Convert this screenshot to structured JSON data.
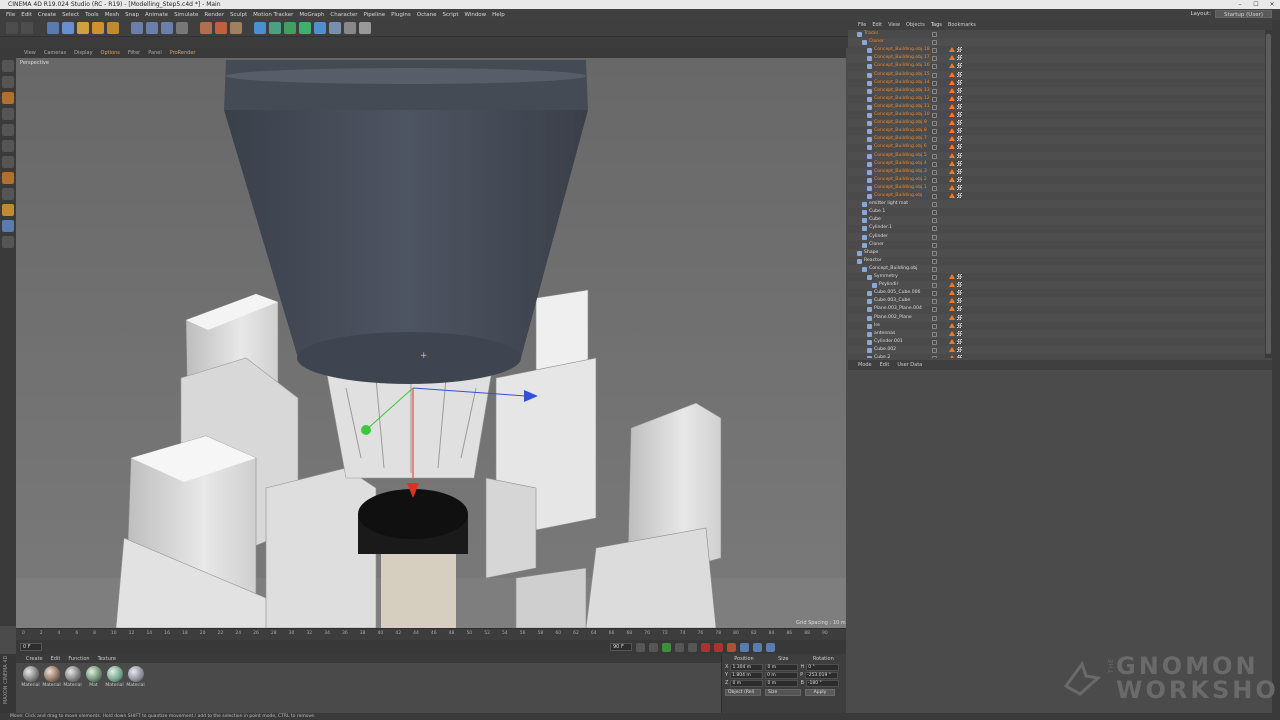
{
  "window": {
    "title": "CINEMA 4D R19.024 Studio (RC - R19) - [Modelling_Step5.c4d *] - Main",
    "controls": [
      "–",
      "☐",
      "✕"
    ]
  },
  "menubar": {
    "items": [
      "File",
      "Edit",
      "Create",
      "Select",
      "Tools",
      "Mesh",
      "Snap",
      "Animate",
      "Simulate",
      "Render",
      "Sculpt",
      "Motion Tracker",
      "MoGraph",
      "Character",
      "Pipeline",
      "Plugins",
      "Octane",
      "Script",
      "Window",
      "Help"
    ],
    "layout_label": "Layout:",
    "layout_value": "Startup (User)"
  },
  "viewport": {
    "menu": [
      "View",
      "Cameras",
      "Display",
      "Options",
      "Filter",
      "Panel",
      "ProRender"
    ],
    "active_menu": "Options",
    "label": "Perspective",
    "grid_spacing": "Grid Spacing : 10 m"
  },
  "timeline": {
    "ticks": [
      "0",
      "2",
      "4",
      "6",
      "8",
      "10",
      "12",
      "14",
      "16",
      "18",
      "20",
      "22",
      "24",
      "26",
      "28",
      "30",
      "32",
      "34",
      "36",
      "38",
      "40",
      "42",
      "44",
      "46",
      "48",
      "50",
      "52",
      "54",
      "56",
      "58",
      "60",
      "62",
      "64",
      "66",
      "68",
      "70",
      "72",
      "74",
      "76",
      "78",
      "80",
      "82",
      "84",
      "86",
      "88",
      "90"
    ],
    "end_label": "0 F",
    "current_frame": "0 F",
    "start_field": "0 F",
    "end_field": "90 F",
    "end_field2": "90 F"
  },
  "materials": {
    "menu": [
      "Create",
      "Edit",
      "Function",
      "Texture"
    ],
    "items": [
      "Material",
      "Material",
      "Material",
      "Mat",
      "Material",
      "Material"
    ]
  },
  "coordinates": {
    "headers": [
      "Position",
      "Size",
      "Rotation"
    ],
    "rows": [
      {
        "axis": "X",
        "pos": "1.304 m",
        "size": "0 m",
        "rot_axis": "H",
        "rot": "0 °"
      },
      {
        "axis": "Y",
        "pos": "1.804 m",
        "size": "0 m",
        "rot_axis": "P",
        "rot": "-253.019 °"
      },
      {
        "axis": "Z",
        "pos": "0 m",
        "size": "0 m",
        "rot_axis": "B",
        "rot": "-180 °"
      }
    ],
    "mode": "Object (Rel)",
    "size_mode": "Size",
    "apply": "Apply"
  },
  "status": "Move: Click and drag to move elements. Hold down SHIFT to quantize movement / add to the selection in point mode, CTRL to remove.",
  "object_manager": {
    "menu": [
      "File",
      "Edit",
      "View",
      "Objects",
      "Tags",
      "Bookmarks"
    ],
    "rows": [
      {
        "name": "Tracks",
        "indent": 1,
        "color": "orange"
      },
      {
        "name": "Cloner",
        "indent": 2,
        "color": "orange"
      },
      {
        "name": "Concept_Building.obj.18",
        "indent": 3,
        "color": "orange"
      },
      {
        "name": "Concept_Building.obj.17",
        "indent": 3,
        "color": "orange"
      },
      {
        "name": "Concept_Building.obj.16",
        "indent": 3,
        "color": "orange"
      },
      {
        "name": "Concept_Building.obj.15",
        "indent": 3,
        "color": "orange"
      },
      {
        "name": "Concept_Building.obj.14",
        "indent": 3,
        "color": "orange"
      },
      {
        "name": "Concept_Building.obj.13",
        "indent": 3,
        "color": "orange"
      },
      {
        "name": "Concept_Building.obj.12",
        "indent": 3,
        "color": "orange"
      },
      {
        "name": "Concept_Building.obj.11",
        "indent": 3,
        "color": "orange"
      },
      {
        "name": "Concept_Building.obj.10",
        "indent": 3,
        "color": "orange"
      },
      {
        "name": "Concept_Building.obj.9",
        "indent": 3,
        "color": "orange"
      },
      {
        "name": "Concept_Building.obj.8",
        "indent": 3,
        "color": "orange"
      },
      {
        "name": "Concept_Building.obj.7",
        "indent": 3,
        "color": "orange"
      },
      {
        "name": "Concept_Building.obj.6",
        "indent": 3,
        "color": "orange"
      },
      {
        "name": "Concept_Building.obj.5",
        "indent": 3,
        "color": "orange"
      },
      {
        "name": "Concept_Building.obj.4",
        "indent": 3,
        "color": "orange"
      },
      {
        "name": "Concept_Building.obj.3",
        "indent": 3,
        "color": "orange"
      },
      {
        "name": "Concept_Building.obj.2",
        "indent": 3,
        "color": "orange"
      },
      {
        "name": "Concept_Building.obj.1",
        "indent": 3,
        "color": "orange"
      },
      {
        "name": "Concept_Building.obj",
        "indent": 3,
        "color": "orange"
      },
      {
        "name": "emitter light mat",
        "indent": 2,
        "color": "white"
      },
      {
        "name": "Cube.1",
        "indent": 2,
        "color": "white"
      },
      {
        "name": "Cube",
        "indent": 2,
        "color": "white"
      },
      {
        "name": "Cylinder.1",
        "indent": 2,
        "color": "white"
      },
      {
        "name": "Cylinder",
        "indent": 2,
        "color": "white"
      },
      {
        "name": "Cloner",
        "indent": 2,
        "color": "white"
      },
      {
        "name": "Shape",
        "indent": 1,
        "color": "white"
      },
      {
        "name": "Reactor",
        "indent": 1,
        "color": "white"
      },
      {
        "name": "Concept_Building.obj",
        "indent": 2,
        "color": "white"
      },
      {
        "name": "Symmetry",
        "indent": 3,
        "color": "white"
      },
      {
        "name": "Psylindir",
        "indent": 4,
        "color": "white"
      },
      {
        "name": "Cube.005_Cube.006",
        "indent": 3,
        "color": "white"
      },
      {
        "name": "Cube.003_Cube",
        "indent": 3,
        "color": "white"
      },
      {
        "name": "Plane.003_Plane.004",
        "indent": 3,
        "color": "white"
      },
      {
        "name": "Plane.002_Plane",
        "indent": 3,
        "color": "white"
      },
      {
        "name": "Ire",
        "indent": 3,
        "color": "white"
      },
      {
        "name": "antennas",
        "indent": 3,
        "color": "white"
      },
      {
        "name": "Cylinder.001",
        "indent": 3,
        "color": "white"
      },
      {
        "name": "Cube.002",
        "indent": 3,
        "color": "white"
      },
      {
        "name": "Cube.2",
        "indent": 3,
        "color": "white"
      }
    ]
  },
  "attribute_manager": {
    "menu": [
      "Mode",
      "Edit",
      "User Data"
    ]
  },
  "watermark": {
    "the": "THE",
    "line1": "GNOMON",
    "line2": "WORKSHOP"
  },
  "colors": {
    "accent": "#f08a2a",
    "axis_x": "#e03020",
    "axis_y": "#3cc83c",
    "axis_z": "#3050e0"
  }
}
